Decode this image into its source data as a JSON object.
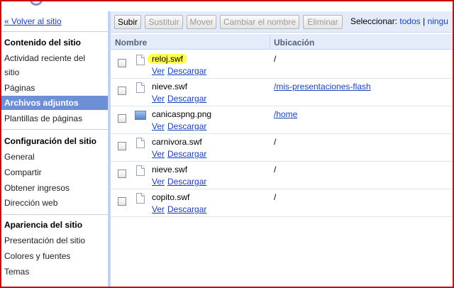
{
  "sidebar": {
    "back_link": "« Volver al sitio",
    "sections": [
      {
        "heading": "Contenido del sitio",
        "items": [
          "Actividad reciente del",
          "sitio",
          "Páginas",
          "Archivos adjuntos",
          "Plantillas de páginas"
        ]
      },
      {
        "heading": "Configuración del sitio",
        "items": [
          "General",
          "Compartir",
          "Obtener ingresos",
          "Dirección web"
        ]
      },
      {
        "heading": "Apariencia del sitio",
        "items": [
          "Presentación del sitio",
          "Colores y fuentes",
          "Temas"
        ]
      }
    ],
    "active_item": "Archivos adjuntos"
  },
  "toolbar": {
    "buttons": [
      "Subir",
      "Sustituir",
      "Mover",
      "Cambiar el nombre",
      "Eliminar"
    ],
    "select_label": "Seleccionar:",
    "select_all": "todos",
    "select_none": "ningu"
  },
  "table": {
    "headers": {
      "name": "Nombre",
      "location": "Ubicación"
    },
    "actions": {
      "view": "Ver",
      "download": "Descargar"
    },
    "rows": [
      {
        "name": "reloj.swf",
        "location": "/",
        "icon": "document-icon",
        "highlighted": true
      },
      {
        "name": "nieve.swf",
        "location": "/mis-presentaciones-flash",
        "icon": "document-icon"
      },
      {
        "name": "canicaspng.png",
        "location": "/home",
        "icon": "image-icon"
      },
      {
        "name": "carnivora.swf",
        "location": "/",
        "icon": "document-icon"
      },
      {
        "name": "nieve.swf",
        "location": "/",
        "icon": "document-icon"
      },
      {
        "name": "copito.swf",
        "location": "/",
        "icon": "document-icon"
      }
    ]
  },
  "colors": {
    "accent": "#6d8fd6",
    "header_bg": "#e5ecf9",
    "link": "#1a3fb6",
    "highlight": "#ffff55",
    "frame": "#cc0000"
  }
}
